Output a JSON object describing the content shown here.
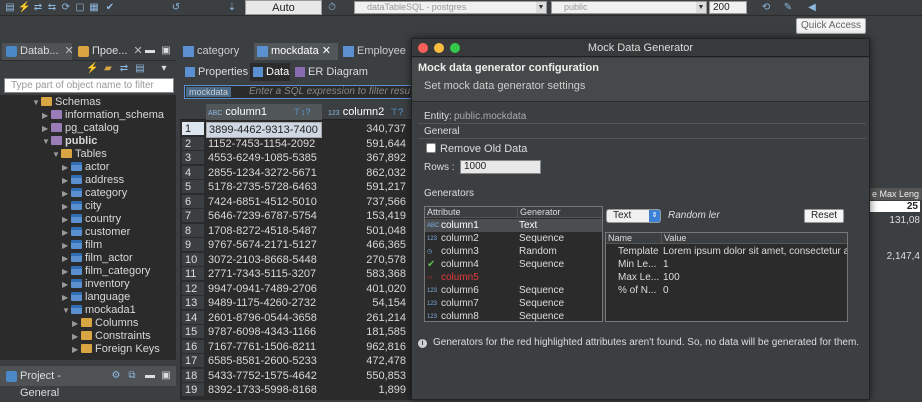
{
  "toolbar": {
    "transaction_mode": "Auto",
    "datasource": "dataTableSQL - postgres",
    "schema": "public",
    "result_limit": "200",
    "quick_access": "Quick Access"
  },
  "left_panel": {
    "tabs": [
      "Datab...",
      "Прое..."
    ],
    "filter_placeholder": "Type part of object name to filter",
    "tree": [
      {
        "label": "Schemas",
        "level": 0,
        "icon": "folder",
        "expanded": true
      },
      {
        "label": "information_schema",
        "level": 1,
        "icon": "schema",
        "expanded": false
      },
      {
        "label": "pg_catalog",
        "level": 1,
        "icon": "schema",
        "expanded": false
      },
      {
        "label": "public",
        "level": 1,
        "icon": "schema",
        "expanded": true,
        "bold": true
      },
      {
        "label": "Tables",
        "level": 2,
        "icon": "folder",
        "expanded": true
      },
      {
        "label": "actor",
        "level": 3,
        "icon": "table"
      },
      {
        "label": "address",
        "level": 3,
        "icon": "table"
      },
      {
        "label": "category",
        "level": 3,
        "icon": "table"
      },
      {
        "label": "city",
        "level": 3,
        "icon": "table"
      },
      {
        "label": "country",
        "level": 3,
        "icon": "table"
      },
      {
        "label": "customer",
        "level": 3,
        "icon": "table"
      },
      {
        "label": "film",
        "level": 3,
        "icon": "table"
      },
      {
        "label": "film_actor",
        "level": 3,
        "icon": "table"
      },
      {
        "label": "film_category",
        "level": 3,
        "icon": "table"
      },
      {
        "label": "inventory",
        "level": 3,
        "icon": "table"
      },
      {
        "label": "language",
        "level": 3,
        "icon": "table"
      },
      {
        "label": "mockada1",
        "level": 3,
        "icon": "table",
        "expanded": true
      },
      {
        "label": "Columns",
        "level": 4,
        "icon": "folder"
      },
      {
        "label": "Constraints",
        "level": 4,
        "icon": "folder"
      },
      {
        "label": "Foreign Keys",
        "level": 4,
        "icon": "folder"
      }
    ],
    "project_tab": "Project - General"
  },
  "editor": {
    "tabs": [
      "category",
      "mockdata",
      "Employee"
    ],
    "active_tab": "mockdata",
    "subtabs": [
      "Properties",
      "Data",
      "ER Diagram"
    ],
    "active_subtab": "Data",
    "filter_entity": "mockdata",
    "filter_placeholder": "Enter a SQL expression to filter resu",
    "columns": [
      "column1",
      "column2"
    ],
    "rows": [
      {
        "n": "1",
        "c1": "3899-4462-9313-7400",
        "c2": "340,737"
      },
      {
        "n": "2",
        "c1": "1152-7453-1154-2092",
        "c2": "591,644"
      },
      {
        "n": "3",
        "c1": "4553-6249-1085-5385",
        "c2": "367,892"
      },
      {
        "n": "4",
        "c1": "2855-1234-3272-5671",
        "c2": "862,032"
      },
      {
        "n": "5",
        "c1": "5178-2735-5728-6463",
        "c2": "591,217"
      },
      {
        "n": "6",
        "c1": "7424-6851-4512-5010",
        "c2": "737,566"
      },
      {
        "n": "7",
        "c1": "5646-7239-6787-5754",
        "c2": "153,419"
      },
      {
        "n": "8",
        "c1": "1708-8272-4518-5487",
        "c2": "501,048"
      },
      {
        "n": "9",
        "c1": "9767-5674-2171-5127",
        "c2": "466,365"
      },
      {
        "n": "10",
        "c1": "3072-2103-8668-5448",
        "c2": "270,578"
      },
      {
        "n": "11",
        "c1": "2771-7343-5115-3207",
        "c2": "583,368"
      },
      {
        "n": "12",
        "c1": "9947-0941-7489-2706",
        "c2": "401,020"
      },
      {
        "n": "13",
        "c1": "9489-1175-4260-2732",
        "c2": "54,154"
      },
      {
        "n": "14",
        "c1": "2601-8796-0544-3658",
        "c2": "261,214"
      },
      {
        "n": "15",
        "c1": "9787-6098-4343-1166",
        "c2": "181,585"
      },
      {
        "n": "16",
        "c1": "7167-7761-1506-8211",
        "c2": "962,816"
      },
      {
        "n": "17",
        "c1": "6585-8581-2600-5233",
        "c2": "472,478"
      },
      {
        "n": "18",
        "c1": "5433-7752-1575-4642",
        "c2": "550,853"
      },
      {
        "n": "19",
        "c1": "8392-1733-5998-8168",
        "c2": "1,899"
      }
    ]
  },
  "right_panel": {
    "header": "e Max Leng",
    "values": [
      "25",
      "131,08",
      "2,147,4"
    ]
  },
  "dialog": {
    "title": "Mock Data Generator",
    "header_title": "Mock data generator configuration",
    "header_subtitle": "Set mock data generator settings",
    "entity_label": "Entity:",
    "entity_value": "public.mockdata",
    "general_label": "General",
    "remove_old_label": "Remove Old Data",
    "rows_label": "Rows :",
    "rows_value": "1000",
    "generators_label": "Generators",
    "gen_headers": [
      "Attribute",
      "Generator"
    ],
    "generators": [
      {
        "attr": "column1",
        "gen": "Text",
        "icon": "ABC",
        "state": "selected"
      },
      {
        "attr": "column2",
        "gen": "Sequence",
        "icon": "123",
        "state": ""
      },
      {
        "attr": "column3",
        "gen": "Random",
        "icon": "clock",
        "state": ""
      },
      {
        "attr": "column4",
        "gen": "Sequence",
        "icon": "check",
        "state": "check"
      },
      {
        "attr": "column5",
        "gen": "",
        "icon": "box",
        "state": "red"
      },
      {
        "attr": "column6",
        "gen": "Sequence",
        "icon": "123",
        "state": ""
      },
      {
        "attr": "column7",
        "gen": "Sequence",
        "icon": "123",
        "state": ""
      },
      {
        "attr": "column8",
        "gen": "Sequence",
        "icon": "123",
        "state": ""
      }
    ],
    "type_select": "Text",
    "generator_name": "Random ler",
    "reset_label": "Reset",
    "prop_headers": [
      "Name",
      "Value"
    ],
    "properties": [
      {
        "name": "Template",
        "value": "Lorem ipsum dolor sit amet, consectetur a"
      },
      {
        "name": "Min Le...",
        "value": "1"
      },
      {
        "name": "Max Le...",
        "value": "100"
      },
      {
        "name": "% of N...",
        "value": "0"
      }
    ],
    "note": "Generators for the red highlighted attributes aren't found. So, no data will be generated for them."
  },
  "colors": {
    "accent": "#4a88c7",
    "error": "#e03b3b",
    "success": "#5dbb4f",
    "background": "#3c3f41",
    "panel": "#2b2b2b"
  }
}
